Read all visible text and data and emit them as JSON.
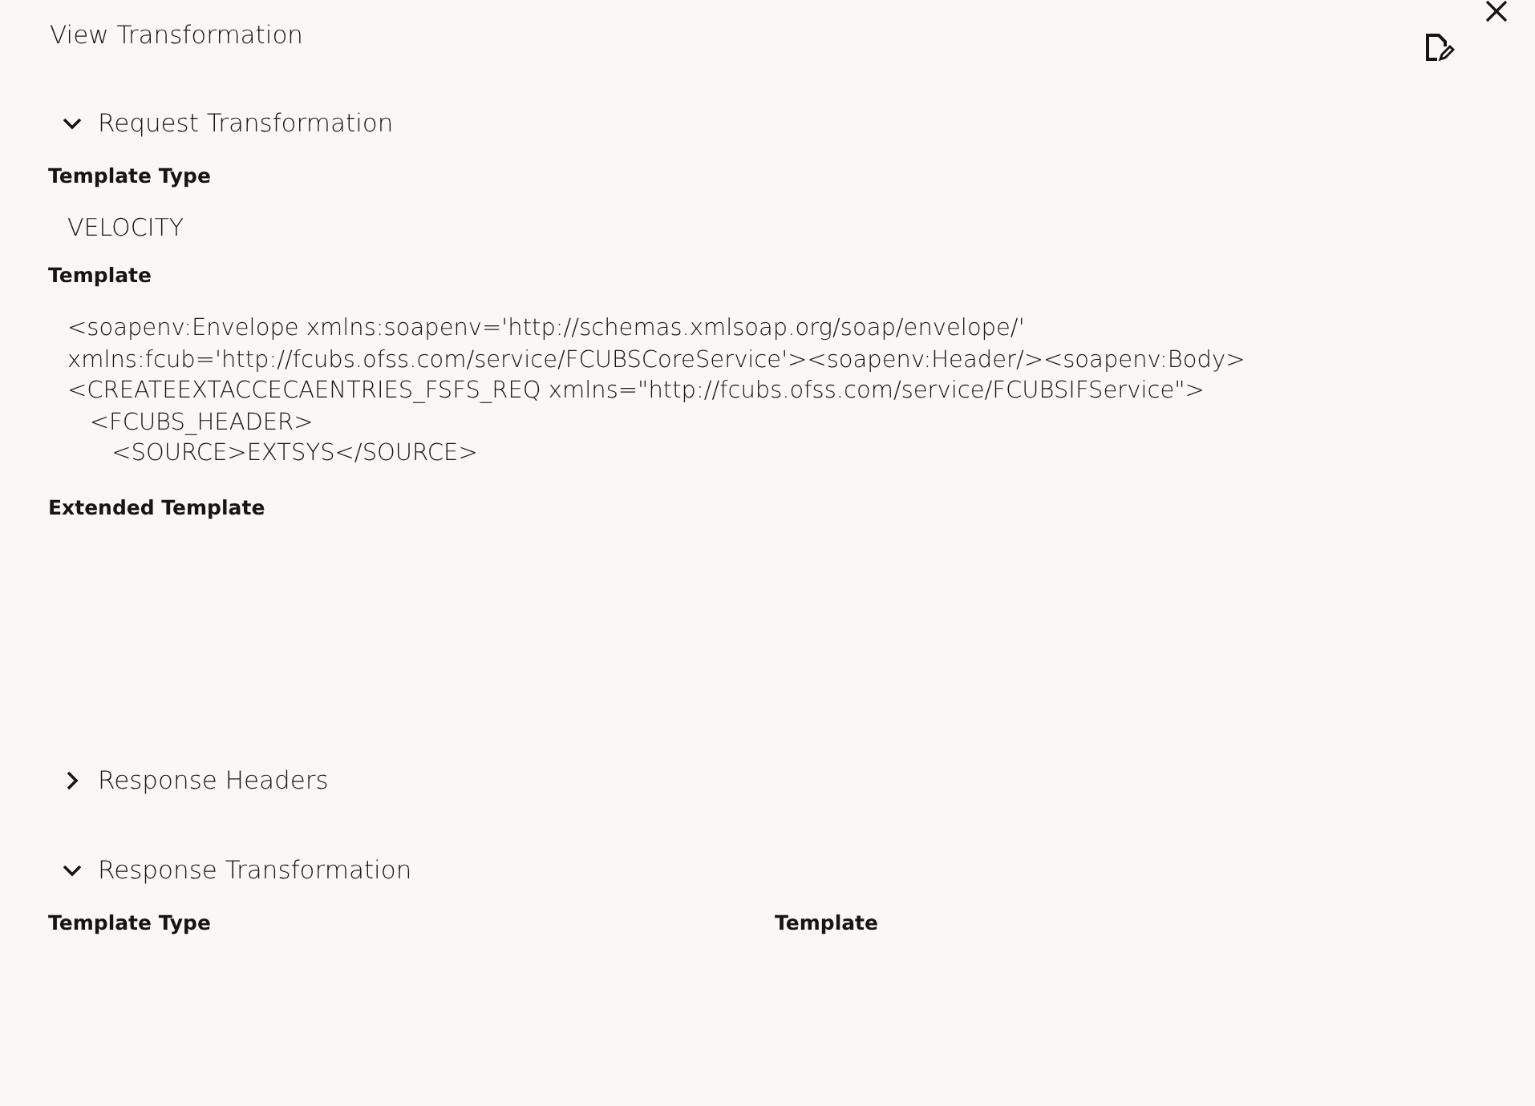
{
  "dialog": {
    "title": "View Transformation"
  },
  "sections": [
    {
      "title": "Request Transformation",
      "expanded": true,
      "kind": "stacked",
      "fields": [
        {
          "label": "Template Type",
          "kind": "text",
          "value": "VELOCITY"
        },
        {
          "label": "Template",
          "kind": "code",
          "lines": [
            "<soapenv:Envelope xmlns:soapenv='http://schemas.xmlsoap.org/soap/envelope/'",
            "xmlns:fcub='http://fcubs.ofss.com/service/FCUBSCoreService'><soapenv:Header/><soapenv:Body>",
            "<CREATEEXTACCECAENTRIES_FSFS_REQ xmlns=\"http://fcubs.ofss.com/service/FCUBSIFService\">",
            "   <FCUBS_HEADER>",
            "      <SOURCE>EXTSYS</SOURCE>"
          ]
        },
        {
          "label": "Extended Template",
          "kind": "empty"
        }
      ]
    },
    {
      "title": "Response Headers",
      "expanded": false
    },
    {
      "title": "Response Transformation",
      "expanded": true,
      "kind": "columns",
      "fields": [
        {
          "label": "Template Type",
          "kind": "empty"
        },
        {
          "label": "Template",
          "kind": "empty"
        }
      ]
    }
  ]
}
